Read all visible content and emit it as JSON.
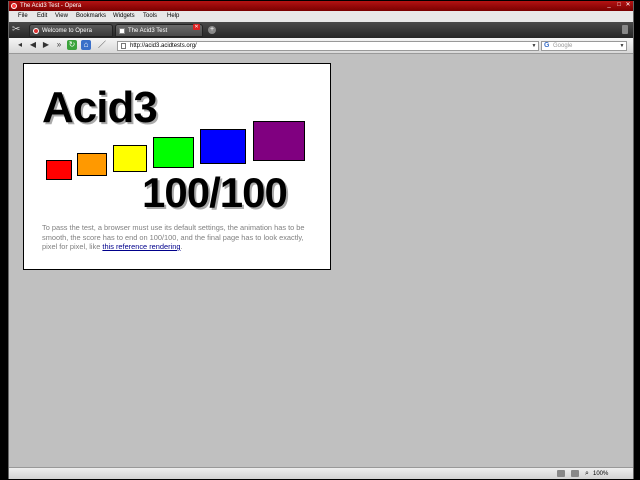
{
  "window": {
    "title": "The Acid3 Test - Opera"
  },
  "menu": {
    "items": [
      "File",
      "Edit",
      "View",
      "Bookmarks",
      "Widgets",
      "Tools",
      "Help"
    ]
  },
  "tabs": [
    {
      "label": "Welcome to Opera"
    },
    {
      "label": "The Acid3 Test"
    }
  ],
  "address": {
    "url": "http://acid3.acidtests.org/"
  },
  "search": {
    "placeholder": "Google"
  },
  "page": {
    "heading": "Acid3",
    "score": "100/100",
    "description": "To pass the test, a browser must use its default settings, the animation has to be smooth, the score has to end on 100/100, and the final page has to look exactly, pixel for pixel, like ",
    "link_text": "this reference rendering",
    "description_end": ".",
    "squares": [
      "#ff0000",
      "#ff9900",
      "#ffff00",
      "#00ff00",
      "#0000ff",
      "#800080"
    ]
  },
  "status": {
    "zoom": "100%"
  }
}
